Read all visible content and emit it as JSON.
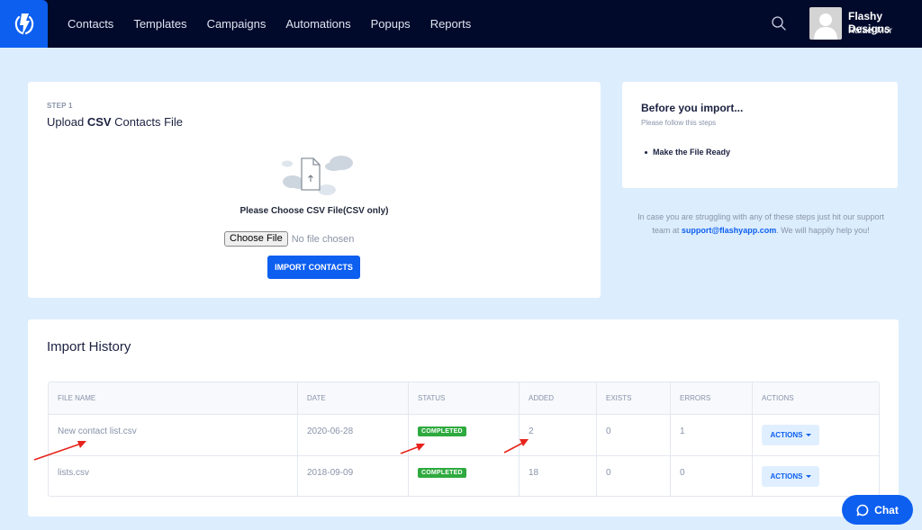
{
  "nav": {
    "items": [
      "Contacts",
      "Templates",
      "Campaigns",
      "Automations",
      "Popups",
      "Reports"
    ]
  },
  "user": {
    "company": "Flashy Designs",
    "name": "Rafael Mor"
  },
  "upload": {
    "step": "STEP 1",
    "title_prefix": "Upload ",
    "title_bold": "CSV",
    "title_suffix": " Contacts File",
    "choose_prompt": "Please Choose CSV File(CSV only)",
    "choose_button": "Choose File",
    "no_file": "No file chosen",
    "import_button": "IMPORT CONTACTS"
  },
  "info": {
    "title": "Before you import...",
    "subtitle": "Please follow this steps",
    "steps": [
      "Make the File Ready"
    ]
  },
  "support": {
    "before": "In case you are struggling with any of these steps just hit our support team at ",
    "email": "support@flashyapp.com",
    "after": ". We will happily help you!"
  },
  "history": {
    "title": "Import History",
    "columns": [
      "FILE NAME",
      "DATE",
      "STATUS",
      "ADDED",
      "EXISTS",
      "ERRORS",
      "ACTIONS"
    ],
    "rows": [
      {
        "file": "New contact list.csv",
        "date": "2020-06-28",
        "status": "COMPLETED",
        "added": "2",
        "exists": "0",
        "errors": "1",
        "action": "ACTIONS"
      },
      {
        "file": "lists.csv",
        "date": "2018-09-09",
        "status": "COMPLETED",
        "added": "18",
        "exists": "0",
        "errors": "0",
        "action": "ACTIONS"
      }
    ]
  },
  "chat": {
    "label": "Chat"
  },
  "colors": {
    "topbar": "#020a2b",
    "accent": "#0d5ff0",
    "background": "#dcedfd",
    "success": "#2eaa3e",
    "annotation_arrow": "#e8231c"
  }
}
